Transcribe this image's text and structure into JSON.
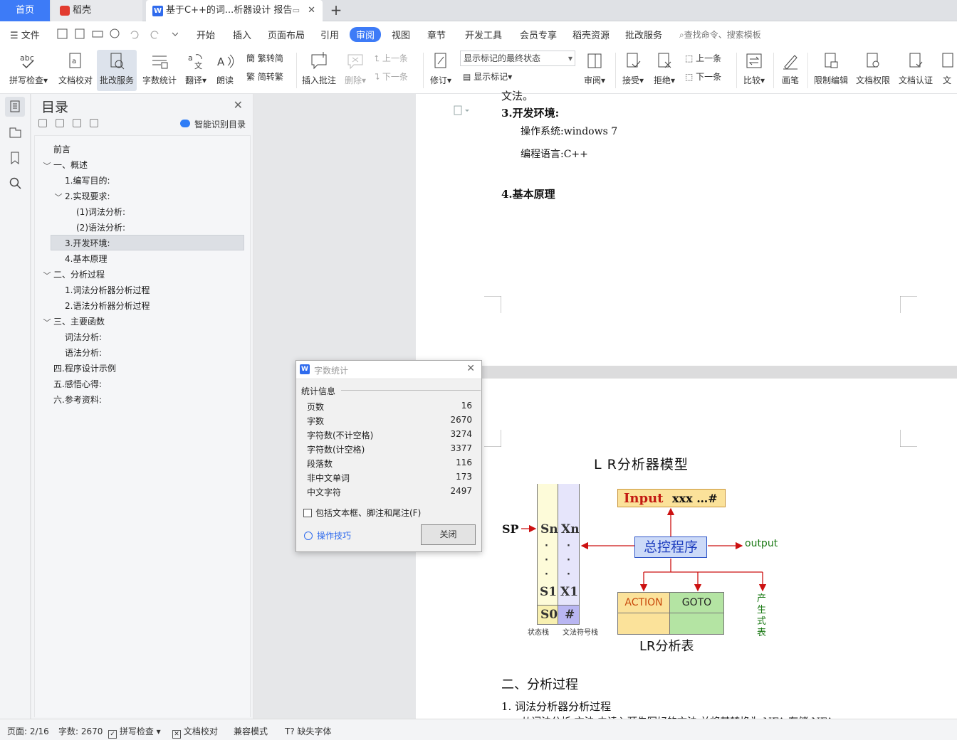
{
  "tabs": {
    "home": "首页",
    "daoke": "稻壳",
    "doc": "基于C++的词...析器设计 报告"
  },
  "menu": {
    "file": "文件",
    "items": [
      "开始",
      "插入",
      "页面布局",
      "引用",
      "审阅",
      "视图",
      "章节",
      "开发工具",
      "会员专享",
      "稻壳资源",
      "批改服务"
    ],
    "active": "审阅",
    "search": "查找命令、搜索模板"
  },
  "ribbon": {
    "spell": "拼写检查",
    "proof": "文档校对",
    "correct": "批改服务",
    "wordcount": "字数统计",
    "translate": "翻译",
    "read": "朗读",
    "trad": "繁转简",
    "simp": "简转繁",
    "insert_comment": "插入批注",
    "delete": "删除",
    "prev": "上一条",
    "next": "下一条",
    "revise": "修订",
    "markup_select": "显示标记的最终状态",
    "show_markup": "显示标记",
    "review": "审阅",
    "accept": "接受",
    "reject": "拒绝",
    "prev2": "上一条",
    "next2": "下一条",
    "compare": "比较",
    "pen": "画笔",
    "restrict": "限制编辑",
    "rights": "文档权限",
    "certify": "文档认证",
    "more": "文"
  },
  "toc": {
    "title": "目录",
    "smart": "智能识别目录",
    "items": [
      "前言",
      "一、概述",
      "1.编写目的:",
      "2.实现要求:",
      "(1)词法分析:",
      "(2)语法分析:",
      "3.开发环境:",
      "4.基本原理",
      "二、分析过程",
      "1.词法分析器分析过程",
      "2.语法分析器分析过程",
      "三、主要函数",
      "词法分析:",
      "语法分析:",
      "四.程序设计示例",
      "五.感悟心得:",
      "六.参考资料:"
    ]
  },
  "doc": {
    "cut_top": "文法。",
    "h3": "3.开发环境:",
    "os": "操作系统:windows 7",
    "lang": "编程语言:C++",
    "h4": "4.基本原理",
    "section2": "二、分析过程",
    "sub1": "1. 词法分析器分析过程",
    "cut_bottom": "从词法分析 文法 由读入预先写好的文法 并将其转换为 NFA 存储 NFA"
  },
  "diagram": {
    "title": "L R分析器模型",
    "input_label": "Input",
    "input_value": "xxx …#",
    "sp": "SP",
    "sn": "Sn",
    "xn": "Xn",
    "s1": "S1",
    "x1": "X1",
    "s0": "S0",
    "hash": "#",
    "dot": "·",
    "control": "总控程序",
    "output": "output",
    "action": "ACTION",
    "goto": "GOTO",
    "table": "LR分析表",
    "production": "产生式表",
    "state_stack": "状态栈",
    "symbol_stack": "文法符号栈"
  },
  "dialog": {
    "title": "字数统计",
    "section": "统计信息",
    "rows": [
      {
        "k": "页数",
        "v": "16"
      },
      {
        "k": "字数",
        "v": "2670"
      },
      {
        "k": "字符数(不计空格)",
        "v": "3274"
      },
      {
        "k": "字符数(计空格)",
        "v": "3377"
      },
      {
        "k": "段落数",
        "v": "116"
      },
      {
        "k": "非中文单词",
        "v": "173"
      },
      {
        "k": "中文字符",
        "v": "2497"
      }
    ],
    "checkbox": "包括文本框、脚注和尾注(F)",
    "tips": "操作技巧",
    "close": "关闭"
  },
  "status": {
    "page": "页面: 2/16",
    "words": "字数: 2670",
    "spell": "拼写检查",
    "proof": "文档校对",
    "compat": "兼容模式",
    "missing_font": "缺失字体"
  }
}
